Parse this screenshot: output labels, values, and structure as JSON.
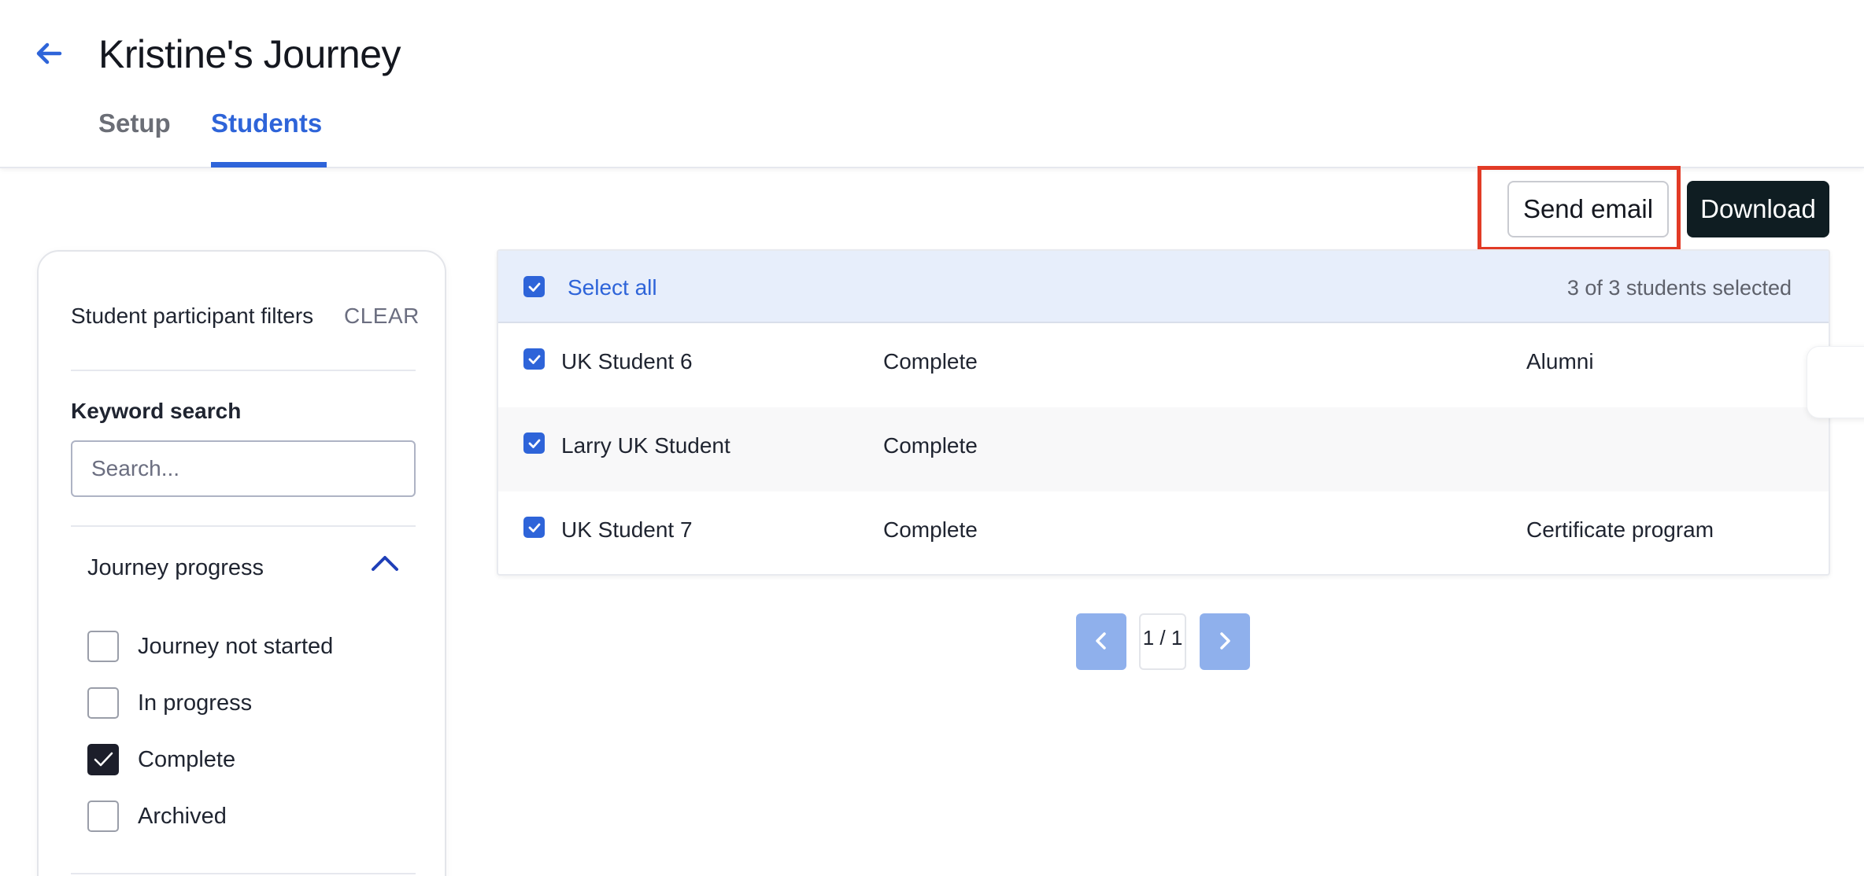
{
  "header": {
    "back_icon": "arrow-left-icon",
    "title": "Kristine's Journey",
    "tabs": [
      {
        "label": "Setup",
        "active": false
      },
      {
        "label": "Students",
        "active": true
      }
    ]
  },
  "actions": {
    "send_email": "Send email",
    "download": "Download"
  },
  "filters": {
    "title": "Student participant filters",
    "clear": "CLEAR",
    "keyword_label": "Keyword search",
    "search_placeholder": "Search...",
    "search_value": "",
    "journey_progress": {
      "label": "Journey progress",
      "expanded": true,
      "options": [
        {
          "label": "Journey not started",
          "checked": false
        },
        {
          "label": "In progress",
          "checked": false
        },
        {
          "label": "Complete",
          "checked": true
        },
        {
          "label": "Archived",
          "checked": false
        }
      ]
    }
  },
  "table": {
    "select_all": "Select all",
    "selected_count": "3 of 3 students selected",
    "rows": [
      {
        "name": "UK Student 6",
        "status": "Complete",
        "program": "Alumni",
        "checked": true
      },
      {
        "name": "Larry UK Student",
        "status": "Complete",
        "program": "",
        "checked": true
      },
      {
        "name": "UK Student 7",
        "status": "Complete",
        "program": "Certificate program",
        "checked": true
      }
    ]
  },
  "pagination": {
    "page_label": "1 / 1",
    "prev_icon": "chevron-left-icon",
    "next_icon": "chevron-right-icon"
  },
  "colors": {
    "accent": "#2e64d9",
    "highlight": "#e23b26",
    "download_bg": "#0f1d22"
  }
}
